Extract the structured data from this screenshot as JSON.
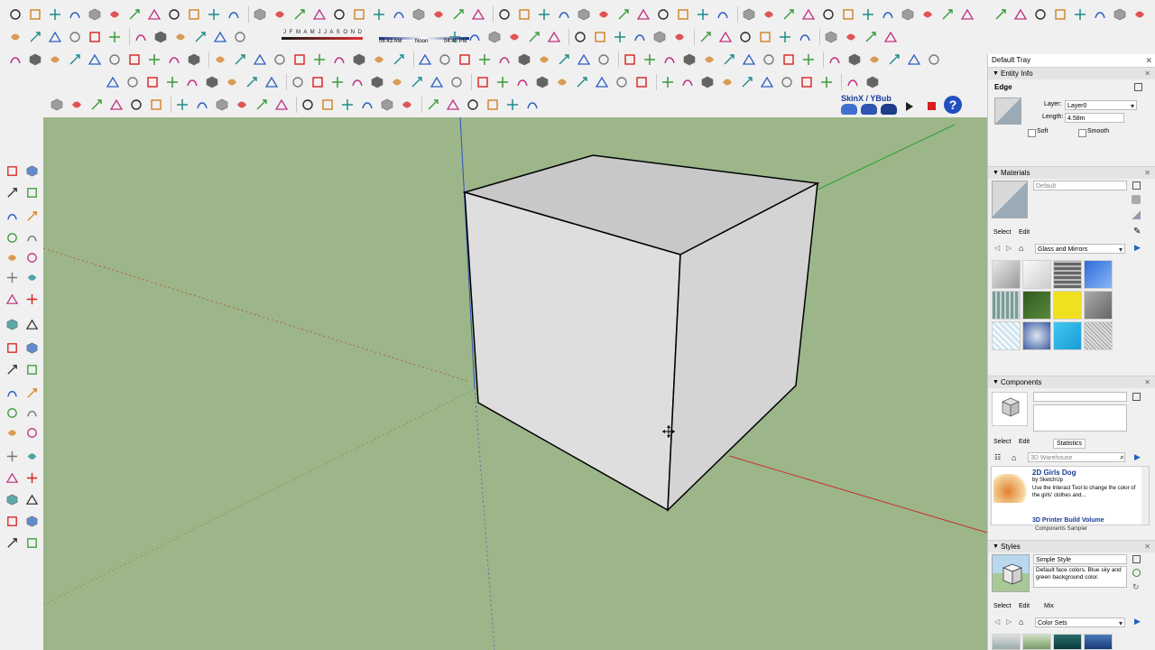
{
  "toolbar": {
    "shadow_months": "J F M A M J J A S O N D",
    "time_start": "06:43 AM",
    "time_noon": "Noon",
    "time_end": "04:45 PM",
    "plugin_label": "SkinX / YBub"
  },
  "tray": {
    "title": "Default Tray",
    "entity_info": {
      "header": "Entity Info",
      "type": "Edge",
      "layer_label": "Layer:",
      "layer_value": "Layer0",
      "length_label": "Length:",
      "length_value": "4.58m",
      "soft_label": "Soft",
      "smooth_label": "Smooth"
    },
    "materials": {
      "header": "Materials",
      "name_value": "Default",
      "tab_select": "Select",
      "tab_edit": "Edit",
      "library": "Glass and Mirrors"
    },
    "components": {
      "header": "Components",
      "tab_select": "Select",
      "tab_edit": "Edit",
      "tab_statistics": "Statistics",
      "search_placeholder": "3D Warehouse",
      "item1_title": "2D Girls Dog",
      "item1_author": "by SketchUp",
      "item1_desc": "Use the Interact Tool to change the color of the girls' clothes and...",
      "item2_title": "3D Printer Build Volume",
      "footer": "Components Sampler"
    },
    "styles": {
      "header": "Styles",
      "name_value": "Simple Style",
      "description": "Default face colors. Blue sky and green background color.",
      "tab_select": "Select",
      "tab_edit": "Edit",
      "tab_mix": "Mix",
      "collection": "Color Sets"
    }
  },
  "colors": {
    "viewport_bg": "#9cb68a",
    "toolbar_bg": "#f0f0f0",
    "accent_red": "#d92020",
    "edge_line": "#000000"
  }
}
